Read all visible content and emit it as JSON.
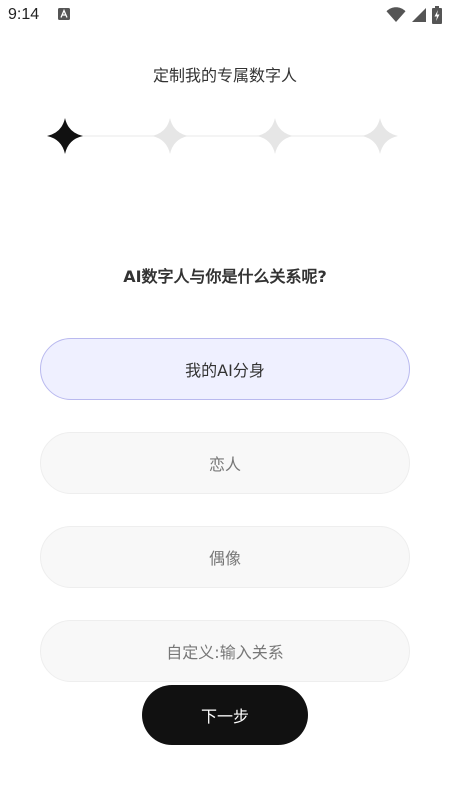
{
  "status_bar": {
    "time": "9:14",
    "app_icon": "android-a-icon",
    "wifi_icon": "wifi-icon",
    "signal_icon": "cell-signal-icon",
    "battery_icon": "battery-charging-icon"
  },
  "header": {
    "title": "定制我的专属数字人"
  },
  "progress": {
    "total_steps": 4,
    "current_step": 1,
    "active_color": "#111111",
    "inactive_color": "#e6e6e6"
  },
  "question": {
    "text": "AI数字人与你是什么关系呢?"
  },
  "options": [
    {
      "label": "我的AI分身",
      "selected": true
    },
    {
      "label": "恋人",
      "selected": false
    },
    {
      "label": "偶像",
      "selected": false
    },
    {
      "label": "自定义:输入关系",
      "selected": false
    }
  ],
  "footer": {
    "next_label": "下一步"
  }
}
